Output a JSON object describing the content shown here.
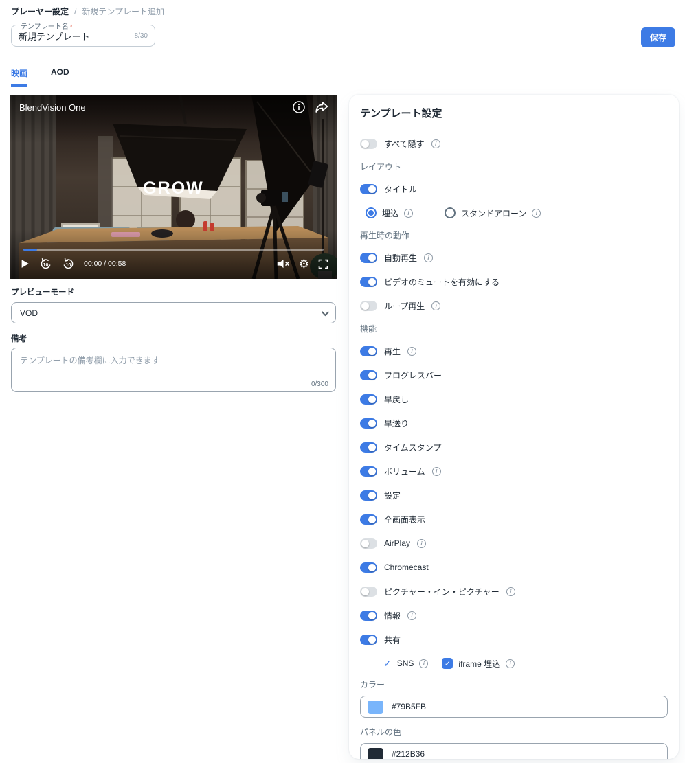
{
  "breadcrumb": {
    "items": [
      "プレーヤー設定",
      "新規テンプレート追加"
    ],
    "separator": "/"
  },
  "header": {
    "save_label": "保存"
  },
  "name_field": {
    "label": "テンプレート名",
    "required_mark": "*",
    "value": "新規テンプレート",
    "counter": "8/30"
  },
  "tabs": [
    {
      "label": "映画",
      "active": true
    },
    {
      "label": "AOD",
      "active": false
    }
  ],
  "player": {
    "title": "BlendVision One",
    "overlay_text": "GROW",
    "time": "00:00 / 00:58",
    "skip_label": "10",
    "progress_style": "width:4.5%"
  },
  "preview_mode": {
    "label": "プレビューモード",
    "value": "VOD"
  },
  "notes": {
    "label": "備考",
    "placeholder": "テンプレートの備考欄に入力できます",
    "counter": "0/300"
  },
  "panel": {
    "title": "テンプレート設定",
    "sections": {
      "layout": "レイアウト",
      "playback": "再生時の動作",
      "features": "機能"
    },
    "toggles": {
      "hide_all": {
        "label": "すべて隠す",
        "on": false,
        "info": true
      },
      "title": {
        "label": "タイトル",
        "on": true,
        "info": false
      },
      "autoplay": {
        "label": "自動再生",
        "on": true,
        "info": true
      },
      "mute": {
        "label": "ビデオのミュートを有効にする",
        "on": true,
        "info": false
      },
      "loop": {
        "label": "ループ再生",
        "on": false,
        "info": true
      },
      "play": {
        "label": "再生",
        "on": true,
        "info": true
      },
      "progressbar": {
        "label": "プログレスバー",
        "on": true,
        "info": false
      },
      "rewind": {
        "label": "早戻し",
        "on": true,
        "info": false
      },
      "forward": {
        "label": "早送り",
        "on": true,
        "info": false
      },
      "timestamp": {
        "label": "タイムスタンプ",
        "on": true,
        "info": false
      },
      "volume": {
        "label": "ボリューム",
        "on": true,
        "info": true
      },
      "settings": {
        "label": "設定",
        "on": true,
        "info": false
      },
      "fullscreen": {
        "label": "全画面表示",
        "on": true,
        "info": false
      },
      "airplay": {
        "label": "AirPlay",
        "on": false,
        "info": true
      },
      "chromecast": {
        "label": "Chromecast",
        "on": true,
        "info": false
      },
      "pip": {
        "label": "ピクチャー・イン・ピクチャー",
        "on": false,
        "info": true
      },
      "info": {
        "label": "情報",
        "on": true,
        "info": true
      },
      "share": {
        "label": "共有",
        "on": true,
        "info": false
      }
    },
    "radio": {
      "embed": {
        "label": "埋込",
        "selected": true
      },
      "standalone": {
        "label": "スタンドアローン",
        "selected": false
      }
    },
    "checkboxes": {
      "sns": {
        "label": "SNS",
        "checked": true
      },
      "iframe": {
        "label": "iframe 埋込",
        "checked": true
      }
    },
    "color_fields": {
      "color": {
        "label": "カラー",
        "value": "#79B5FB",
        "swatch_style": "background:#79B5FB"
      },
      "panel_color": {
        "label": "パネルの色",
        "value": "#212B36",
        "swatch_style": "background:#212B36"
      }
    }
  },
  "icons": {
    "info_glyph": "i",
    "check_glyph": "✓",
    "settings_glyph": "⚙"
  },
  "colors": {
    "accent": "#3D7BE5",
    "text": "#212B36",
    "muted": "#637381",
    "border": "#C4CDD5"
  }
}
